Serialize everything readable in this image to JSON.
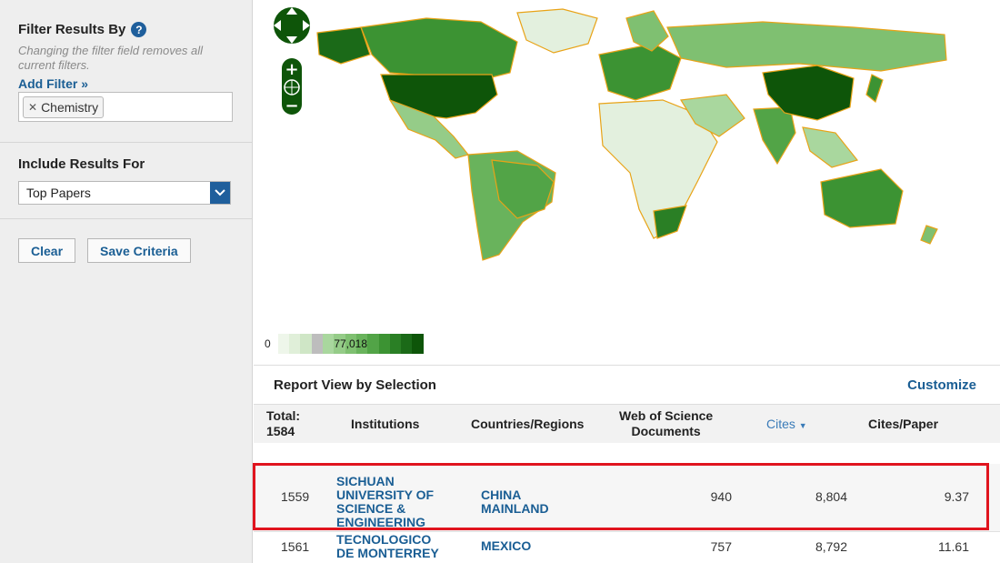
{
  "sidebar": {
    "filter_title": "Filter Results By",
    "filter_hint": "Changing the filter field removes all current filters.",
    "add_filter": "Add Filter »",
    "chip": "Chemistry",
    "include_title": "Include Results For",
    "include_value": "Top Papers",
    "clear": "Clear",
    "save": "Save Criteria"
  },
  "map": {
    "legend_min": "0",
    "legend_max": "77,018",
    "legend_colors": [
      "#eef6ea",
      "#e0efd9",
      "#cfe6c6",
      "#bdbdbd",
      "#a9d79e",
      "#95cc88",
      "#7fc071",
      "#69b35c",
      "#52a447",
      "#3c9333",
      "#2a7f25",
      "#1b6a18",
      "#0e5509"
    ]
  },
  "report": {
    "title": "Report View by Selection",
    "customize": "Customize",
    "headers": {
      "total": "Total:",
      "total_count": "1584",
      "institutions": "Institutions",
      "countries": "Countries/Regions",
      "wos_line1": "Web of Science",
      "wos_line2": "Documents",
      "cites": "Cites",
      "cites_paper": "Cites/Paper"
    },
    "rows": [
      {
        "rank": "1559",
        "inst1": "SICHUAN",
        "inst2": "UNIVERSITY OF",
        "inst3": "SCIENCE &",
        "inst4": "ENGINEERING",
        "country1": "CHINA",
        "country2": "MAINLAND",
        "docs": "940",
        "cites": "8,804",
        "cpp": "9.37"
      },
      {
        "rank": "1561",
        "inst1": "TECNOLOGICO",
        "inst2": "DE MONTERREY",
        "country1": "MEXICO",
        "docs": "757",
        "cites": "8,792",
        "cpp": "11.61"
      }
    ]
  }
}
